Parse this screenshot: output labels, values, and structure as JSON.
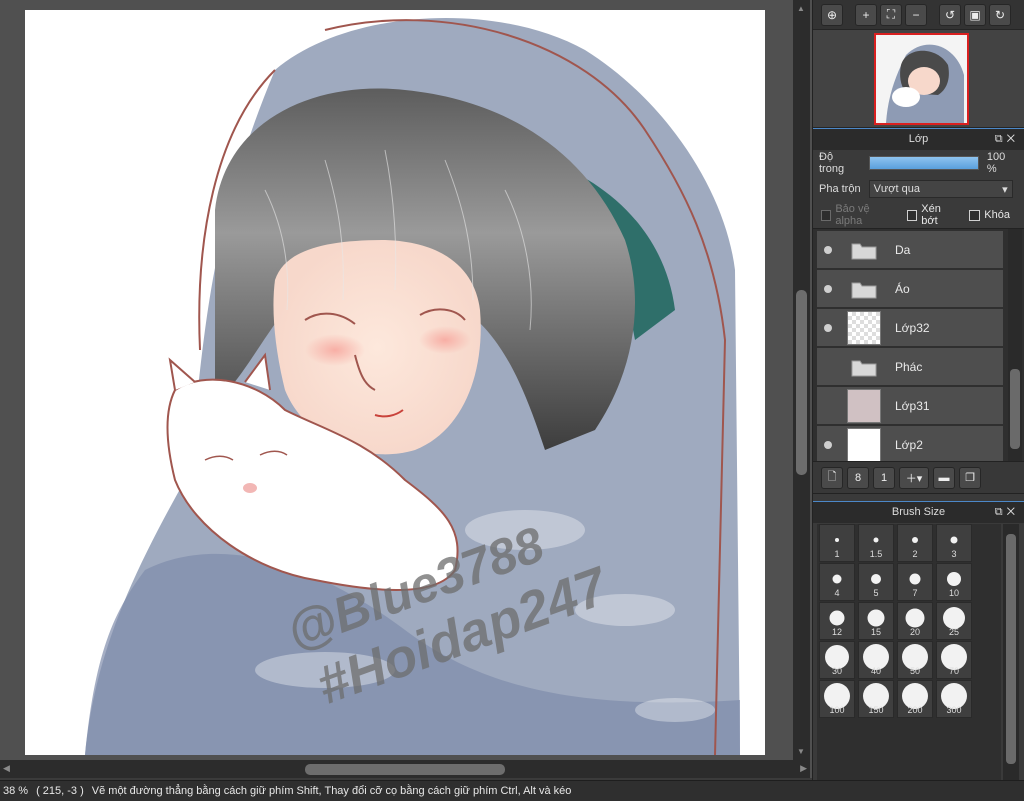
{
  "canvas": {
    "watermark_line1": "@Blue3788",
    "watermark_line2": "#Hoidap247"
  },
  "status_bar": {
    "zoom": "38 %",
    "coords": "( 215, -3 )",
    "hint": "Vẽ một đường thẳng bằng cách giữ phím Shift, Thay đổi cỡ cọ bằng cách giữ phím Ctrl, Alt và kéo"
  },
  "layer_panel": {
    "title": "Lớp",
    "opacity_label": "Độ trong",
    "opacity_value": "100 %",
    "opacity_fraction": 1.0,
    "blend_label": "Pha trộn",
    "blend_value": "Vượt qua",
    "protect_alpha": "Bảo vệ alpha",
    "clipping": "Xén bớt",
    "lock": "Khóa",
    "layers": [
      {
        "name": "Da",
        "kind": "folder",
        "visible": true
      },
      {
        "name": "Áo",
        "kind": "folder",
        "visible": true
      },
      {
        "name": "Lớp32",
        "kind": "transparent",
        "visible": true
      },
      {
        "name": "Phác",
        "kind": "folder",
        "visible": false
      },
      {
        "name": "Lớp31",
        "kind": "pink",
        "visible": false
      },
      {
        "name": "Lớp2",
        "kind": "white",
        "visible": true
      }
    ]
  },
  "brush_panel": {
    "title": "Brush Size",
    "sizes": [
      "1",
      "1.5",
      "2",
      "3",
      "4",
      "5",
      "7",
      "10",
      "12",
      "15",
      "20",
      "25",
      "30",
      "40",
      "50",
      "70",
      "100",
      "150",
      "200",
      "300"
    ]
  },
  "colors": {
    "accent": "#4c88c8",
    "nav_frame": "#d92020",
    "opacity_fill": "#5a9fdc"
  }
}
